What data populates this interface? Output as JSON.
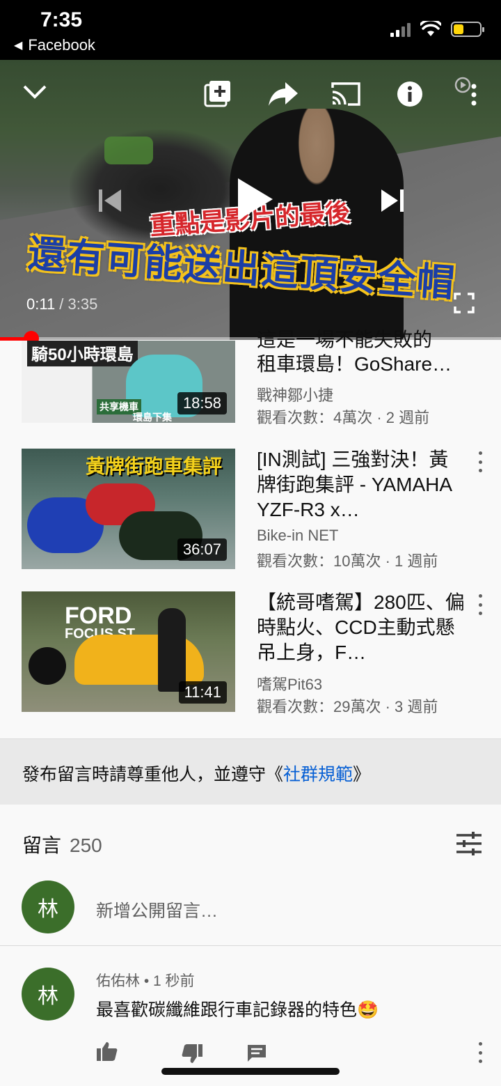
{
  "status": {
    "time": "7:35",
    "back_app": "Facebook"
  },
  "player": {
    "current_time": "0:11",
    "separator": " / ",
    "total_time": "3:35",
    "progress_fraction": 0.051,
    "caption_top": "重點是影片的最後",
    "caption_bottom": "還有可能送出這頂安全帽"
  },
  "videos": [
    {
      "title_line1": "這是一場不能失敗的",
      "title_line2": "租車環島！GoShare…",
      "channel": "戰神鄒小捷",
      "meta": "觀看次數：4萬次 · 2 週前",
      "duration": "18:58",
      "thumb_text": "騎50小時環島",
      "thumb_sub1": "共享機車",
      "thumb_sub2": "環島下集"
    },
    {
      "title": "[IN測試] 三強對決！黃牌街跑集評 - YAMAHA YZF-R3 x…",
      "channel": "Bike-in NET",
      "meta": "觀看次數：10萬次 · 1 週前",
      "duration": "36:07",
      "thumb_text": "黃牌街跑車集評"
    },
    {
      "title": "【統哥嗜駕】280匹、偏時點火、CCD主動式懸吊上身，F…",
      "channel": "嗜駕Pit63",
      "meta": "觀看次數：29萬次 · 3 週前",
      "duration": "11:41",
      "thumb_text1": "FORD",
      "thumb_text2": "FOCUS ST"
    }
  ],
  "guidelines": {
    "prefix": "發布留言時請尊重他人，並遵守《",
    "link": "社群規範",
    "suffix": "》"
  },
  "comments": {
    "label": "留言",
    "count": "250",
    "avatar_letter": "林",
    "add_placeholder": "新增公開留言…",
    "items": [
      {
        "author_meta": "佑佑林 • 1 秒前",
        "text": "最喜歡碳纖維跟行車記錄器的特色🤩",
        "avatar_letter": "林"
      }
    ]
  },
  "colors": {
    "accent_red": "#ff0000",
    "link_blue": "#065fd4",
    "avatar_green": "#3b6e2a"
  }
}
